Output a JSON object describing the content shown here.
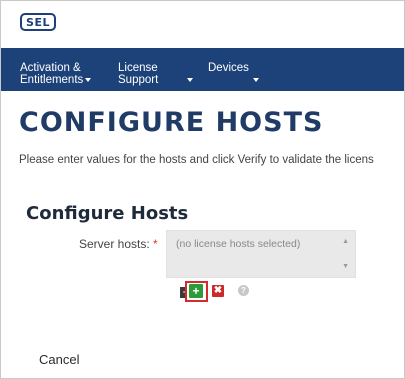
{
  "header": {
    "logo_text": "SEL"
  },
  "nav": {
    "items": [
      {
        "label_line1": "Activation &",
        "label_line2": "Entitlements"
      },
      {
        "label_line1": "License",
        "label_line2": "Support"
      },
      {
        "label_line1": "Devices",
        "label_line2": ""
      }
    ]
  },
  "page": {
    "title": "CONFIGURE HOSTS",
    "instructions": "Please enter values for the hosts and click Verify to validate the licens"
  },
  "section": {
    "title": "Configure Hosts",
    "server_hosts_label": "Server hosts:",
    "required_mark": "*",
    "listbox_placeholder": "(no license hosts selected)"
  },
  "actions": {
    "add_all_symbol": "+",
    "add_symbol": "+",
    "remove_symbol": "✖",
    "help_symbol": "?"
  },
  "footer": {
    "cancel_label": "Cancel"
  },
  "icons": {
    "add_all": "add-all-icon",
    "add": "add-icon",
    "remove": "remove-icon",
    "help": "help-icon",
    "dropdown": "chevron-down-icon"
  },
  "colors": {
    "nav_bg": "#1d4279",
    "title_color": "#1f3b66",
    "add_green": "#2e9b3a",
    "remove_red": "#cc2a2a",
    "highlight_red": "#d42b2b"
  }
}
